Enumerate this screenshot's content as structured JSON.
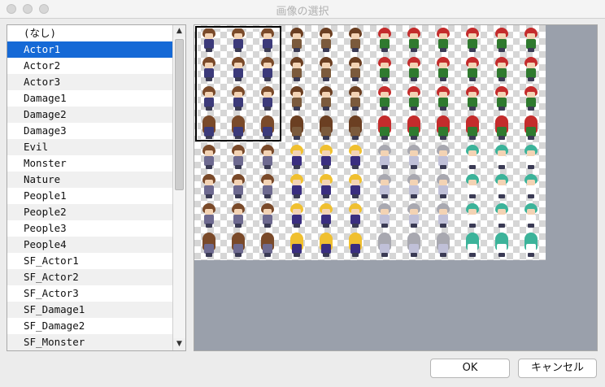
{
  "window": {
    "title": "画像の選択"
  },
  "list": {
    "items": [
      "(なし)",
      "Actor1",
      "Actor2",
      "Actor3",
      "Damage1",
      "Damage2",
      "Damage3",
      "Evil",
      "Monster",
      "Nature",
      "People1",
      "People2",
      "People3",
      "People4",
      "SF_Actor1",
      "SF_Actor2",
      "SF_Actor3",
      "SF_Damage1",
      "SF_Damage2",
      "SF_Monster"
    ],
    "selected_index": 1
  },
  "preview": {
    "image": "Actor1",
    "characters": [
      {
        "hair": "#7a4a2a",
        "body": "#3c3a7a"
      },
      {
        "hair": "#6b3f22",
        "body": "#7b5a3c"
      },
      {
        "hair": "#c42c2c",
        "body": "#2f7a2f"
      },
      {
        "hair": "#c42c2c",
        "body": "#2f7a2f"
      },
      {
        "hair": "#7a4a2a",
        "body": "#6e6a90"
      },
      {
        "hair": "#f0c030",
        "body": "#3a2e80"
      },
      {
        "hair": "#a8a8b0",
        "body": "#c0c0d8"
      },
      {
        "hair": "#3cb39a",
        "body": "#ffffff"
      }
    ]
  },
  "buttons": {
    "ok": "OK",
    "cancel": "キャンセル"
  }
}
